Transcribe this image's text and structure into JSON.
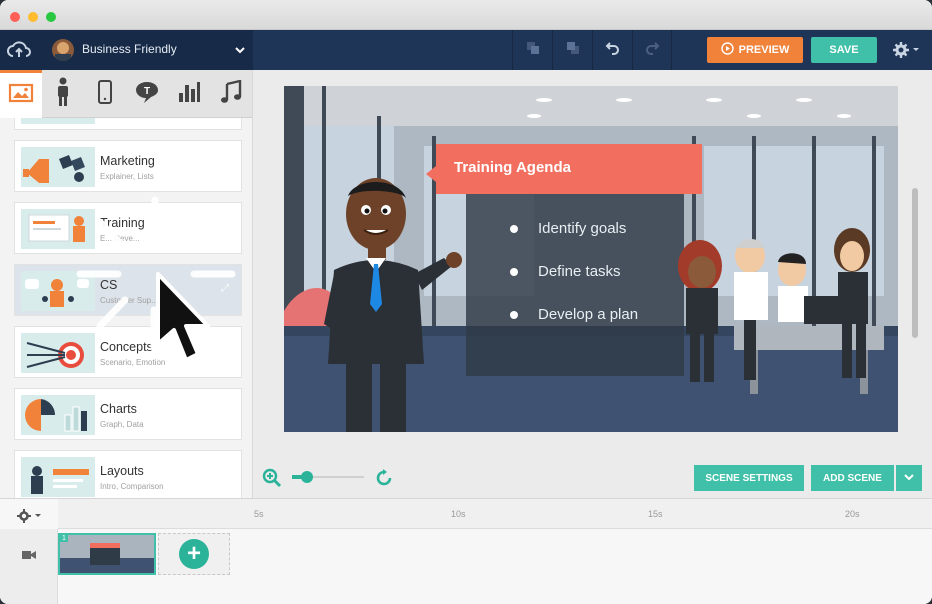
{
  "window": {
    "traffic_lights": [
      "#ff5f57",
      "#febc2e",
      "#28c840"
    ]
  },
  "topbar": {
    "theme_label": "Business Friendly",
    "preview_label": "PREVIEW",
    "save_label": "SAVE"
  },
  "sidebar": {
    "tabs": [
      "image-icon",
      "character-icon",
      "device-icon",
      "text-bubble-icon",
      "chart-icon",
      "music-icon"
    ],
    "items": [
      {
        "name": "Marketing",
        "sub": "Explainer, Lists"
      },
      {
        "name": "Training",
        "sub": "E... Deve..."
      },
      {
        "name": "CS",
        "sub": "Customer Sup..."
      },
      {
        "name": "Concepts",
        "sub": "Scenario, Emotion"
      },
      {
        "name": "Charts",
        "sub": "Graph, Data"
      },
      {
        "name": "Layouts",
        "sub": "Intro, Comparison"
      }
    ]
  },
  "scene": {
    "callout_title": "Training Agenda",
    "bullets": [
      "Identify goals",
      "Define tasks",
      "Develop a plan"
    ]
  },
  "canvas_controls": {
    "zoom_level": 0.15,
    "scene_settings_label": "SCENE SETTINGS",
    "add_scene_label": "ADD SCENE"
  },
  "timeline": {
    "ticks": [
      "5s",
      "10s",
      "15s",
      "20s"
    ],
    "scene_number": "1"
  },
  "colors": {
    "accent_orange": "#f0823a",
    "accent_teal": "#40c0a8",
    "navy": "#1f3557",
    "callout": "#f26f5f"
  }
}
